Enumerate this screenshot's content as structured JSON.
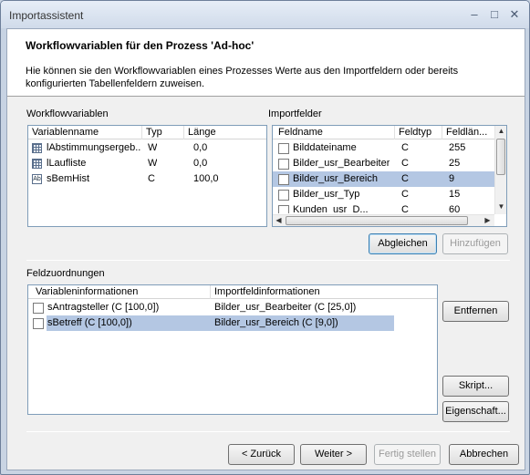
{
  "window": {
    "title": "Importassistent"
  },
  "header": {
    "title": "Workflowvariablen für den Prozess 'Ad-hoc'",
    "description": "Hie können sie den Workflowvariablen eines Prozesses Werte aus den Importfeldern oder bereits konfigurierten Tabellenfeldern zuweisen."
  },
  "workflow_vars": {
    "label": "Workflowvariablen",
    "columns": [
      "Variablenname",
      "Typ",
      "Länge"
    ],
    "rows": [
      {
        "name": "lAbstimmungsergeb...",
        "typ": "W",
        "laenge": "0,0",
        "icon": "table-icon"
      },
      {
        "name": "lLaufliste",
        "typ": "W",
        "laenge": "0,0",
        "icon": "table-icon"
      },
      {
        "name": "sBemHist",
        "typ": "C",
        "laenge": "100,0",
        "icon": "text-field-icon"
      }
    ]
  },
  "importfelder": {
    "label": "Importfelder",
    "columns": [
      "Feldname",
      "Feldtyp",
      "Feldlän..."
    ],
    "rows": [
      {
        "name": "Bilddateiname",
        "typ": "C",
        "laenge": "255"
      },
      {
        "name": "Bilder_usr_Bearbeiter",
        "typ": "C",
        "laenge": "25"
      },
      {
        "name": "Bilder_usr_Bereich",
        "typ": "C",
        "laenge": "9"
      },
      {
        "name": "Bilder_usr_Typ",
        "typ": "C",
        "laenge": "15"
      },
      {
        "name": "Kunden_usr_D...",
        "typ": "C",
        "laenge": "60"
      }
    ],
    "selected_row": 2,
    "buttons": {
      "abgleichen": "Abgleichen",
      "hinzufuegen": "Hinzufügen"
    }
  },
  "feldzuordnungen": {
    "label": "Feldzuordnungen",
    "columns": [
      "Variableninformationen",
      "Importfeldinformationen"
    ],
    "rows": [
      {
        "var": "sAntragsteller (C [100,0])",
        "imp": "Bilder_usr_Bearbeiter (C [25,0])"
      },
      {
        "var": "sBetreff (C [100,0])",
        "imp": "Bilder_usr_Bereich (C [9,0])"
      }
    ],
    "selected_row": 1,
    "buttons": {
      "entfernen": "Entfernen",
      "skript": "Skript...",
      "eigenschaften": "Eigenschaft..."
    }
  },
  "footer": {
    "zurueck": "< Zurück",
    "weiter": "Weiter >",
    "fertig": "Fertig stellen",
    "abbrechen": "Abbrechen"
  }
}
